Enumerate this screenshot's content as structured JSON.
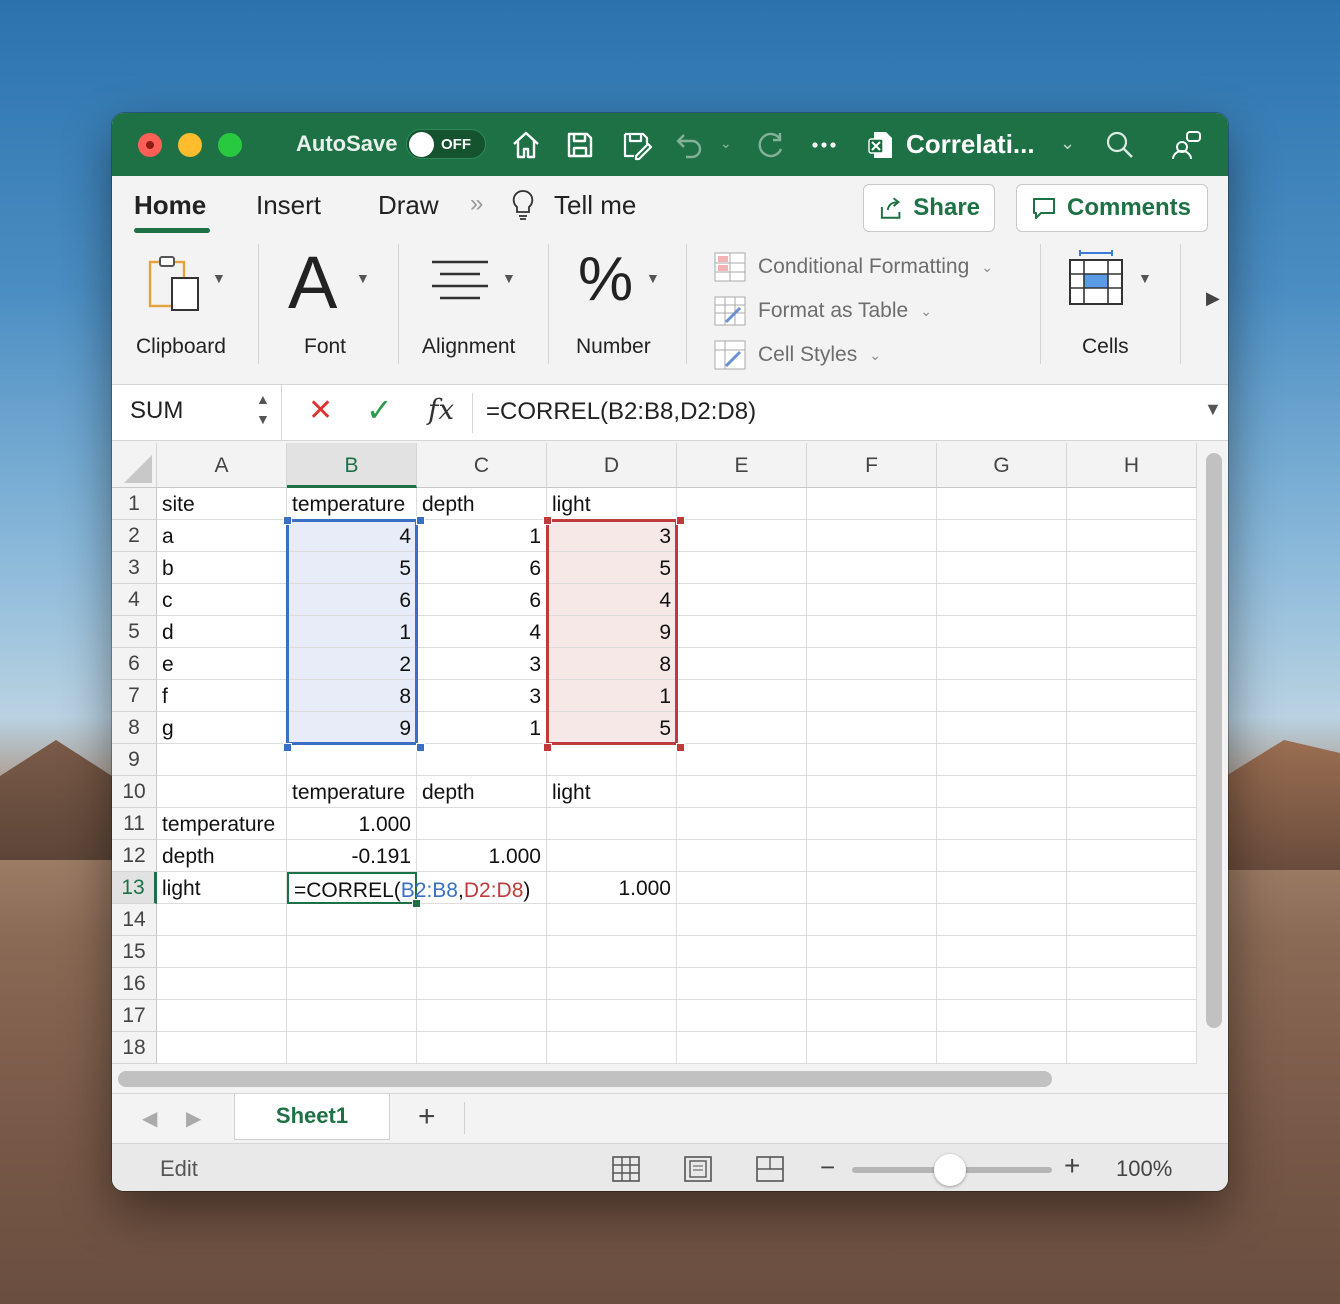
{
  "titlebar": {
    "autosave_label": "AutoSave",
    "autosave_state": "OFF",
    "doc_title": "Correlati...",
    "icons": [
      "home-icon",
      "save-icon",
      "save-as-icon",
      "undo-icon",
      "redo-icon",
      "more-icon",
      "excel-doc-icon",
      "search-icon",
      "people-icon"
    ]
  },
  "tabs": {
    "home": "Home",
    "insert": "Insert",
    "draw": "Draw",
    "tell_me": "Tell me",
    "share": "Share",
    "comments": "Comments"
  },
  "ribbon": {
    "clipboard": "Clipboard",
    "font": "Font",
    "font_glyph": "A",
    "alignment": "Alignment",
    "number": "Number",
    "number_glyph": "%",
    "conditional_formatting": "Conditional Formatting",
    "format_as_table": "Format as Table",
    "cell_styles": "Cell Styles",
    "cells": "Cells"
  },
  "formula_bar": {
    "name_box": "SUM",
    "fx": "fx",
    "formula": "=CORREL(B2:B8,D2:D8)"
  },
  "columns": [
    "A",
    "B",
    "C",
    "D",
    "E",
    "F",
    "G",
    "H"
  ],
  "rows": [
    "1",
    "2",
    "3",
    "4",
    "5",
    "6",
    "7",
    "8",
    "9",
    "10",
    "11",
    "12",
    "13",
    "14",
    "15",
    "16",
    "17",
    "18"
  ],
  "sheet": {
    "r1": [
      "site",
      "temperature",
      "depth",
      "light"
    ],
    "r2": [
      "a",
      "4",
      "1",
      "3"
    ],
    "r3": [
      "b",
      "5",
      "6",
      "5"
    ],
    "r4": [
      "c",
      "6",
      "6",
      "4"
    ],
    "r5": [
      "d",
      "1",
      "4",
      "9"
    ],
    "r6": [
      "e",
      "2",
      "3",
      "8"
    ],
    "r7": [
      "f",
      "8",
      "3",
      "1"
    ],
    "r8": [
      "g",
      "9",
      "1",
      "5"
    ],
    "r10": [
      "",
      "temperature",
      "depth",
      "light"
    ],
    "r11": [
      "temperature",
      "1.000",
      "",
      ""
    ],
    "r12": [
      "depth",
      "-0.191",
      "1.000",
      ""
    ],
    "r13": [
      "light",
      "",
      "",
      "1.000"
    ]
  },
  "edit_cell": {
    "prefix": "=CORREL(",
    "ref1": "B2:B8",
    "comma": ",",
    "ref2": "D2:D8",
    "suffix": ")"
  },
  "sheets": {
    "active": "Sheet1",
    "add": "+"
  },
  "status": {
    "mode": "Edit",
    "zoom": "100%",
    "zoom_minus": "−",
    "zoom_plus": "+"
  },
  "colors": {
    "accent": "#1e7145",
    "ref_blue": "#3a6fc4",
    "ref_red": "#c0393b"
  }
}
